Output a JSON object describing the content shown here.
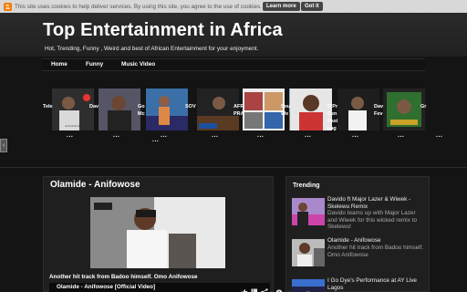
{
  "cookie_bar": {
    "text": "This site uses cookies to help deliver services. By using this site, you agree to the use of cookies.",
    "learn_more_label": "Learn more",
    "got_it_label": "Got it"
  },
  "header": {
    "title": "Top Entertainment in Africa",
    "tagline": "Hot, Trending, Funny , Weird and best of African Entertainment for your enjoyment."
  },
  "nav": {
    "items": [
      {
        "label": "Home"
      },
      {
        "label": "Funny"
      },
      {
        "label": "Music Video"
      }
    ]
  },
  "carousel": {
    "labels": [
      {
        "text": "Tele"
      },
      {
        "text": "Dav"
      },
      {
        "text": "Go"
      },
      {
        "text": "SOV"
      },
      {
        "text": "AFR"
      },
      {
        "text": "Sou"
      },
      {
        "text": "D'Pr"
      },
      {
        "text": "Dav"
      },
      {
        "text": "Gr"
      }
    ],
    "label_sub": {
      "go": "Mc",
      "afr": "PRA",
      "sou": "We",
      "dpr1": "Cen",
      "dpr2": "Pasi",
      "dpr3": "Lag",
      "dav2": "Fev"
    },
    "dots": "..."
  },
  "main_post": {
    "title": "Olamide - Anifowose",
    "caption": "Another hit track from Badoo himself. Omo Anifowose",
    "video_title": "Olamide - Anifowose [Official Video]"
  },
  "trending": {
    "heading": "Trending",
    "items": [
      {
        "title": "Davido ft Major Lazer & Wiwek - Skelewu Remix",
        "desc": "Davido teams up with Major Lazer and Wiwek for this wicked remix to Skelewu!"
      },
      {
        "title": "Olamide - Anifowose",
        "desc": "Another hit track from Badoo himself. Omo Anifowose"
      },
      {
        "title": "I Go Dye's Performance at AY Live Lagos",
        "desc": ""
      }
    ]
  },
  "colors": {
    "background": "#141414",
    "panel": "#1f1f1f",
    "cookie_bar": "#d8d8d8",
    "cookie_icon": "#f57c00"
  }
}
